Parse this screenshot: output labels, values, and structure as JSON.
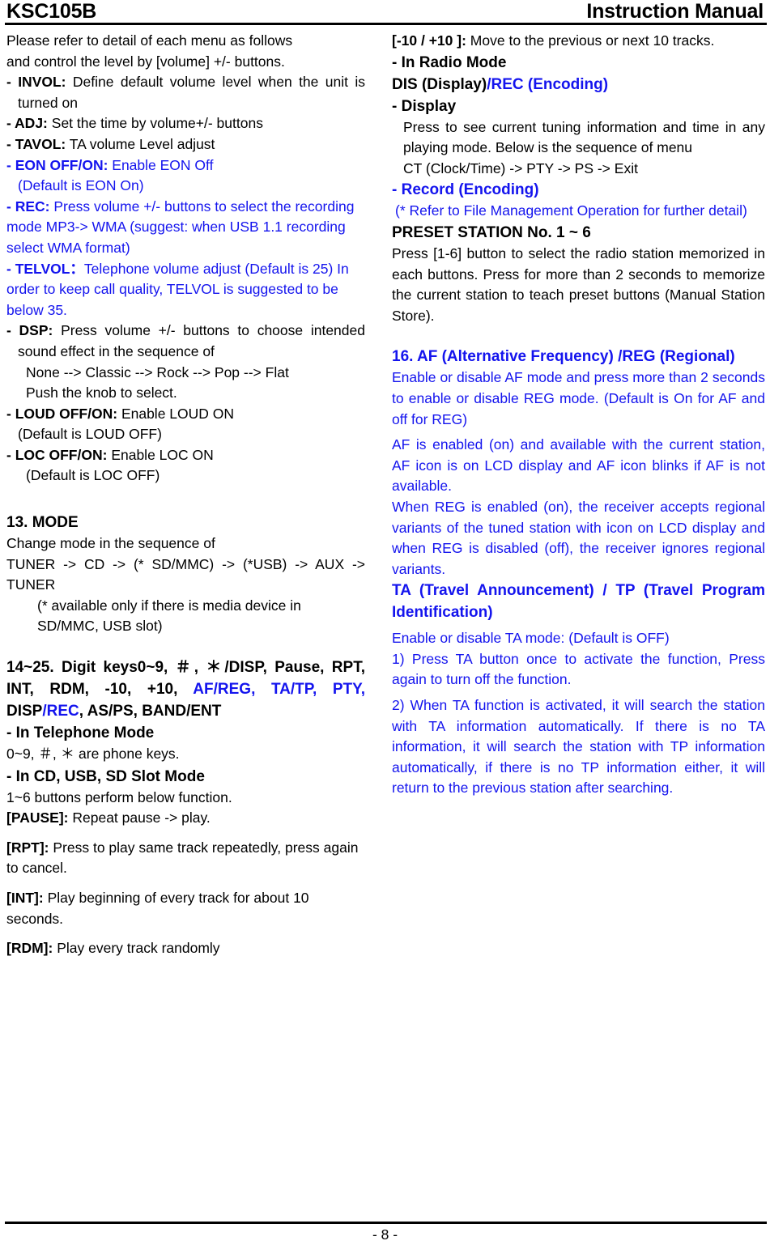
{
  "header": {
    "model": "KSC105B",
    "doc_title": "Instruction Manual"
  },
  "footer": {
    "page_number": "- 8 -"
  },
  "left_column": {
    "intro_line1": "Please refer to detail of each menu as follows",
    "intro_line2": "and control the level by [volume] +/- buttons.",
    "menu_items": [
      {
        "label": "- INVOL:",
        "text": "Define default volume level when the unit is turned on",
        "color": "#000000"
      },
      {
        "label": "- ADJ:",
        "text": "Set the time by volume+/- buttons",
        "color": "#000000"
      },
      {
        "label": "- TAVOL:",
        "text": "TA volume Level adjust",
        "color": "#000000"
      },
      {
        "label": "- EON OFF/ON:",
        "text": "Enable EON Off",
        "color": "#1414ee"
      }
    ],
    "eon_default": "(Default is EON On)",
    "rec_label": "- REC:",
    "rec_text": "Press volume +/- buttons to select the recording mode MP3-> WMA (suggest: when USB 1.1 recording select WMA format)",
    "telvol_label": "- TELVOL：",
    "telvol_text": "Telephone volume adjust (Default is 25) In order to keep call quality, TELVOL is suggested to be below 35.",
    "dsp_label": "- DSP:",
    "dsp_text": "Press volume +/- buttons to choose intended sound effect in the sequence of",
    "dsp_sequence": "None --> Classic --> Rock --> Pop --> Flat",
    "dsp_push": "Push the knob to select.",
    "loud_label": "- LOUD OFF/ON:",
    "loud_text": "Enable LOUD ON",
    "loud_default": "(Default is LOUD OFF)",
    "loc_label": "- LOC OFF/ON:",
    "loc_text": "Enable LOC ON",
    "loc_default": "(Default is LOC OFF)",
    "mode_heading": "13. MODE",
    "mode_line1": "Change mode in the sequence of",
    "mode_line2": "TUNER -> CD -> (* SD/MMC) -> (*USB) -> AUX -> TUNER",
    "mode_note": "(* available only if there is media device in SD/MMC, USB slot)",
    "digit_heading_part1": "14~25.  Digit  keys0~9,  ",
    "digit_heading_hash": "＃",
    "digit_heading_comma": ",  ",
    "digit_heading_star": "＊",
    "digit_heading_part2": "/DISP, Pause, RPT, INT, RDM, -10, +10, ",
    "digit_heading_blue1": "AF/REG,  TA/TP,  PTY,",
    "digit_heading_mid": "  DISP",
    "digit_heading_blue2": "/REC",
    "digit_heading_part3": ", AS/PS, BAND/ENT",
    "telephone_mode_heading": "- In Telephone Mode",
    "telephone_keys_pre": "0~9, ",
    "telephone_keys_hash": "＃",
    "telephone_keys_mid": ", ",
    "telephone_keys_star": "＊",
    "telephone_keys_post": " are phone keys.",
    "cd_usb_sd_heading": "- In CD, USB, SD Slot Mode",
    "buttons_note": "1~6 buttons perform below function.",
    "pause_label": "[PAUSE]:",
    "pause_text": "Repeat pause -> play.",
    "rpt_label": "[RPT]:",
    "rpt_text": "Press to play same track repeatedly, press again to cancel.",
    "int_label": "[INT]:",
    "int_text": "Play beginning of every track for about 10 seconds.",
    "rdm_label": "[RDM]:",
    "rdm_text": "Play every track randomly"
  },
  "right_column": {
    "pm10_label": "[-10 / +10 ]:",
    "pm10_text": "Move to the previous or next 10 tracks.",
    "radio_mode_heading": "- In Radio Mode",
    "dis_display_black": "DIS (Display)",
    "dis_display_blue": "/REC (Encoding)",
    "display_heading": "- Display",
    "display_text": "Press to see current tuning information and time in any playing mode. Below is the sequence of menu",
    "display_sequence": "CT (Clock/Time) -> PTY -> PS -> Exit",
    "record_heading": "- Record (Encoding)",
    "record_note": "(* Refer to File Management Operation for further detail)",
    "preset_heading": "PRESET STATION No. 1 ~ 6",
    "preset_text": "Press [1-6] button to select the radio station memorized in each buttons. Press for more than 2 seconds to memorize the current station to teach preset buttons (Manual Station Store).",
    "af_heading": "16. AF (Alternative Frequency) /REG (Regional)",
    "af_text1": "Enable or disable AF mode and press more than 2 seconds to enable or disable REG mode. (Default is On for AF and off for REG)",
    "af_text2": "AF is enabled (on) and available with the current station, AF icon is on LCD display and AF icon blinks if AF is not available.",
    "af_text3": "When REG is enabled (on), the receiver accepts regional variants of the tuned station with icon on LCD display and when REG is disabled (off), the receiver ignores regional variants.",
    "ta_heading": "TA (Travel Announcement) / TP (Travel Program Identification)",
    "ta_text1": "Enable or disable TA mode: (Default is OFF)",
    "ta_item1": "1) Press TA button once to activate the function, Press again to turn off the function.",
    "ta_item2": "2) When TA function is activated, it will search the station with TA information automatically. If there is no TA information, it will search the station with TP information automatically, if there is no TP information either, it will return to the previous station after searching."
  },
  "colors": {
    "text_black": "#000000",
    "text_blue": "#1414ee",
    "rule": "#000000",
    "background": "#ffffff"
  }
}
